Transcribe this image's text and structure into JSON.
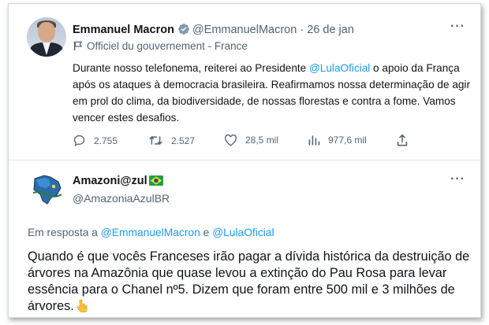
{
  "tweet1": {
    "author_name": "Emmanuel Macron",
    "handle": "@EmmanuelMacron",
    "separator": "·",
    "date": "26 de jan",
    "label": "Officiel du gouvernement - France",
    "text_before": "Durante nosso telefonema, reiterei ao Presidente ",
    "mention": "@LulaOficial",
    "text_after": " o apoio da França após os ataques à democracia brasileira. Reafirmamos nossa determinação de agir em prol do clima, da biodiversidade, de nossas florestas e contra a fome. Vamos vencer estes desafios.",
    "stats": {
      "replies": "2.755",
      "retweets": "2.527",
      "likes": "28,5 mil",
      "views": "977,6 mil"
    }
  },
  "tweet2": {
    "author_name": "Amazoni@zul",
    "handle": "@AmazoniaAzulBR",
    "reply_prefix": "Em resposta a ",
    "reply_mention1": "@EmmanuelMacron",
    "reply_conjunction": " e ",
    "reply_mention2": "@LulaOficial",
    "text": "Quando é que vocês Franceses irão pagar a dívida histórica da destruição de árvores na Amazônia que quase levou a extinção do Pau Rosa para levar essência para o Chanel nº5. Dizem que foram entre 500 mil e 3 milhões de árvores."
  },
  "icons": {
    "more": "more-options-icon",
    "verified": "verified-badge-icon",
    "government_label": "government-label-icon",
    "reply": "reply-icon",
    "retweet": "retweet-icon",
    "like": "heart-icon",
    "views": "views-icon",
    "share": "share-icon",
    "flag": "brazil-flag-icon",
    "emoji": "point-down-emoji"
  },
  "colors": {
    "accent": "#1d9bf0",
    "muted": "#536471",
    "text": "#0f1419",
    "verified_gray": "#829aab"
  }
}
